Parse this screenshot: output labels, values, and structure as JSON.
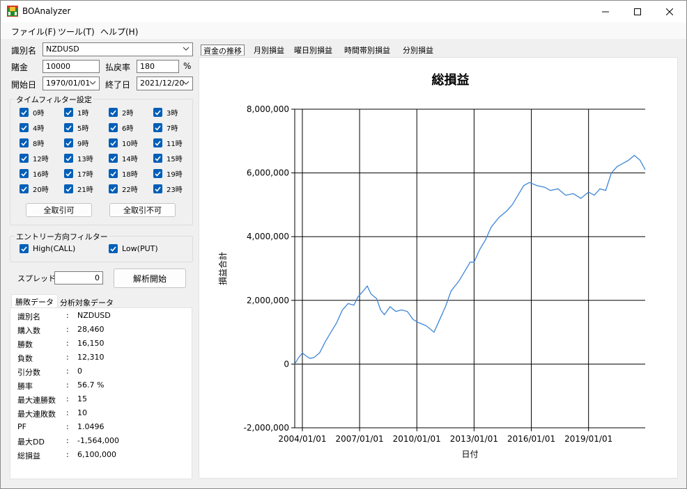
{
  "window": {
    "title": "BOAnalyzer"
  },
  "menu": {
    "items": [
      "ファイル(F)",
      "ツール(T)",
      "ヘルプ(H)"
    ]
  },
  "form": {
    "symbol_label": "識別名",
    "symbol_value": "NZDUSD",
    "stake_label": "賭金",
    "stake_value": "10000",
    "payout_label": "払戻率",
    "payout_value": "180",
    "payout_unit": "%",
    "start_label": "開始日",
    "start_value": "1970/01/01",
    "end_label": "終了日",
    "end_value": "2021/12/20"
  },
  "time_filter": {
    "title": "タイムフィルター設定",
    "hours": [
      "0時",
      "1時",
      "2時",
      "3時",
      "4時",
      "5時",
      "6時",
      "7時",
      "8時",
      "9時",
      "10時",
      "11時",
      "12時",
      "13時",
      "14時",
      "15時",
      "16時",
      "17時",
      "18時",
      "19時",
      "20時",
      "21時",
      "22時",
      "23時"
    ],
    "allow_all": "全取引可",
    "deny_all": "全取引不可"
  },
  "direction_filter": {
    "title": "エントリー方向フィルター",
    "high": "High(CALL)",
    "low": "Low(PUT)"
  },
  "spread": {
    "label": "スプレッド",
    "value": "0"
  },
  "start_button": "解析開始",
  "sub_tabs": [
    "勝敗データ",
    "分析対象データ"
  ],
  "stats": [
    {
      "key": "識別名",
      "value": "NZDUSD"
    },
    {
      "key": "購入数",
      "value": "28,460"
    },
    {
      "key": "勝数",
      "value": "16,150"
    },
    {
      "key": "負数",
      "value": "12,310"
    },
    {
      "key": "引分数",
      "value": "0"
    },
    {
      "key": "勝率",
      "value": "56.7 %"
    },
    {
      "key": "最大連勝数",
      "value": "15"
    },
    {
      "key": "最大連敗数",
      "value": "10"
    },
    {
      "key": "PF",
      "value": "1.0496"
    },
    {
      "key": "最大DD",
      "value": "-1,564,000"
    },
    {
      "key": "総損益",
      "value": "6,100,000"
    }
  ],
  "stats_separator": ":",
  "chart_tabs": [
    "資金の推移",
    "月別損益",
    "曜日別損益",
    "時間帯別損益",
    "分別損益"
  ],
  "chart_data": {
    "type": "line",
    "title": "総損益",
    "xlabel": "日付",
    "ylabel": "損益合計",
    "x_tick_labels": [
      "2004/01/01",
      "2007/01/01",
      "2010/01/01",
      "2013/01/01",
      "2016/01/01",
      "2019/01/01"
    ],
    "y_tick_labels": [
      "8,000,000",
      "6,000,000",
      "4,000,000",
      "2,000,000",
      "0",
      "-2,000,000"
    ],
    "ylim": [
      -2000000,
      8000000
    ],
    "xlim": [
      2003.6,
      2021.97
    ],
    "grid": true,
    "color": "#3d85d8",
    "series": [
      {
        "x": [
          2003.6,
          2003.8,
          2004.0,
          2004.2,
          2004.4,
          2004.6,
          2004.9,
          2005.2,
          2005.5,
          2005.8,
          2006.1,
          2006.4,
          2006.7,
          2006.9,
          2007.2,
          2007.4,
          2007.6,
          2007.9,
          2008.1,
          2008.3,
          2008.6,
          2008.9,
          2009.2,
          2009.5,
          2009.8,
          2010.1,
          2010.5,
          2010.9,
          2011.2,
          2011.5,
          2011.8,
          2012.2,
          2012.5,
          2012.8,
          2013.0,
          2013.3,
          2013.6,
          2013.9,
          2014.3,
          2014.7,
          2015.0,
          2015.3,
          2015.6,
          2015.9,
          2016.3,
          2016.7,
          2017.0,
          2017.4,
          2017.8,
          2018.2,
          2018.6,
          2019.0,
          2019.3,
          2019.6,
          2019.9,
          2020.2,
          2020.5,
          2020.8,
          2021.1,
          2021.4,
          2021.7,
          2021.97
        ],
        "y": [
          0,
          200000,
          350000,
          250000,
          180000,
          200000,
          350000,
          700000,
          1000000,
          1300000,
          1700000,
          1900000,
          1850000,
          2100000,
          2300000,
          2450000,
          2200000,
          2050000,
          1700000,
          1550000,
          1800000,
          1650000,
          1700000,
          1650000,
          1400000,
          1300000,
          1200000,
          1000000,
          1400000,
          1800000,
          2300000,
          2600000,
          2900000,
          3200000,
          3200000,
          3600000,
          3900000,
          4300000,
          4600000,
          4800000,
          5000000,
          5300000,
          5600000,
          5700000,
          5600000,
          5550000,
          5450000,
          5500000,
          5300000,
          5350000,
          5200000,
          5400000,
          5300000,
          5500000,
          5450000,
          6000000,
          6200000,
          6300000,
          6400000,
          6550000,
          6400000,
          6100000
        ]
      }
    ]
  }
}
